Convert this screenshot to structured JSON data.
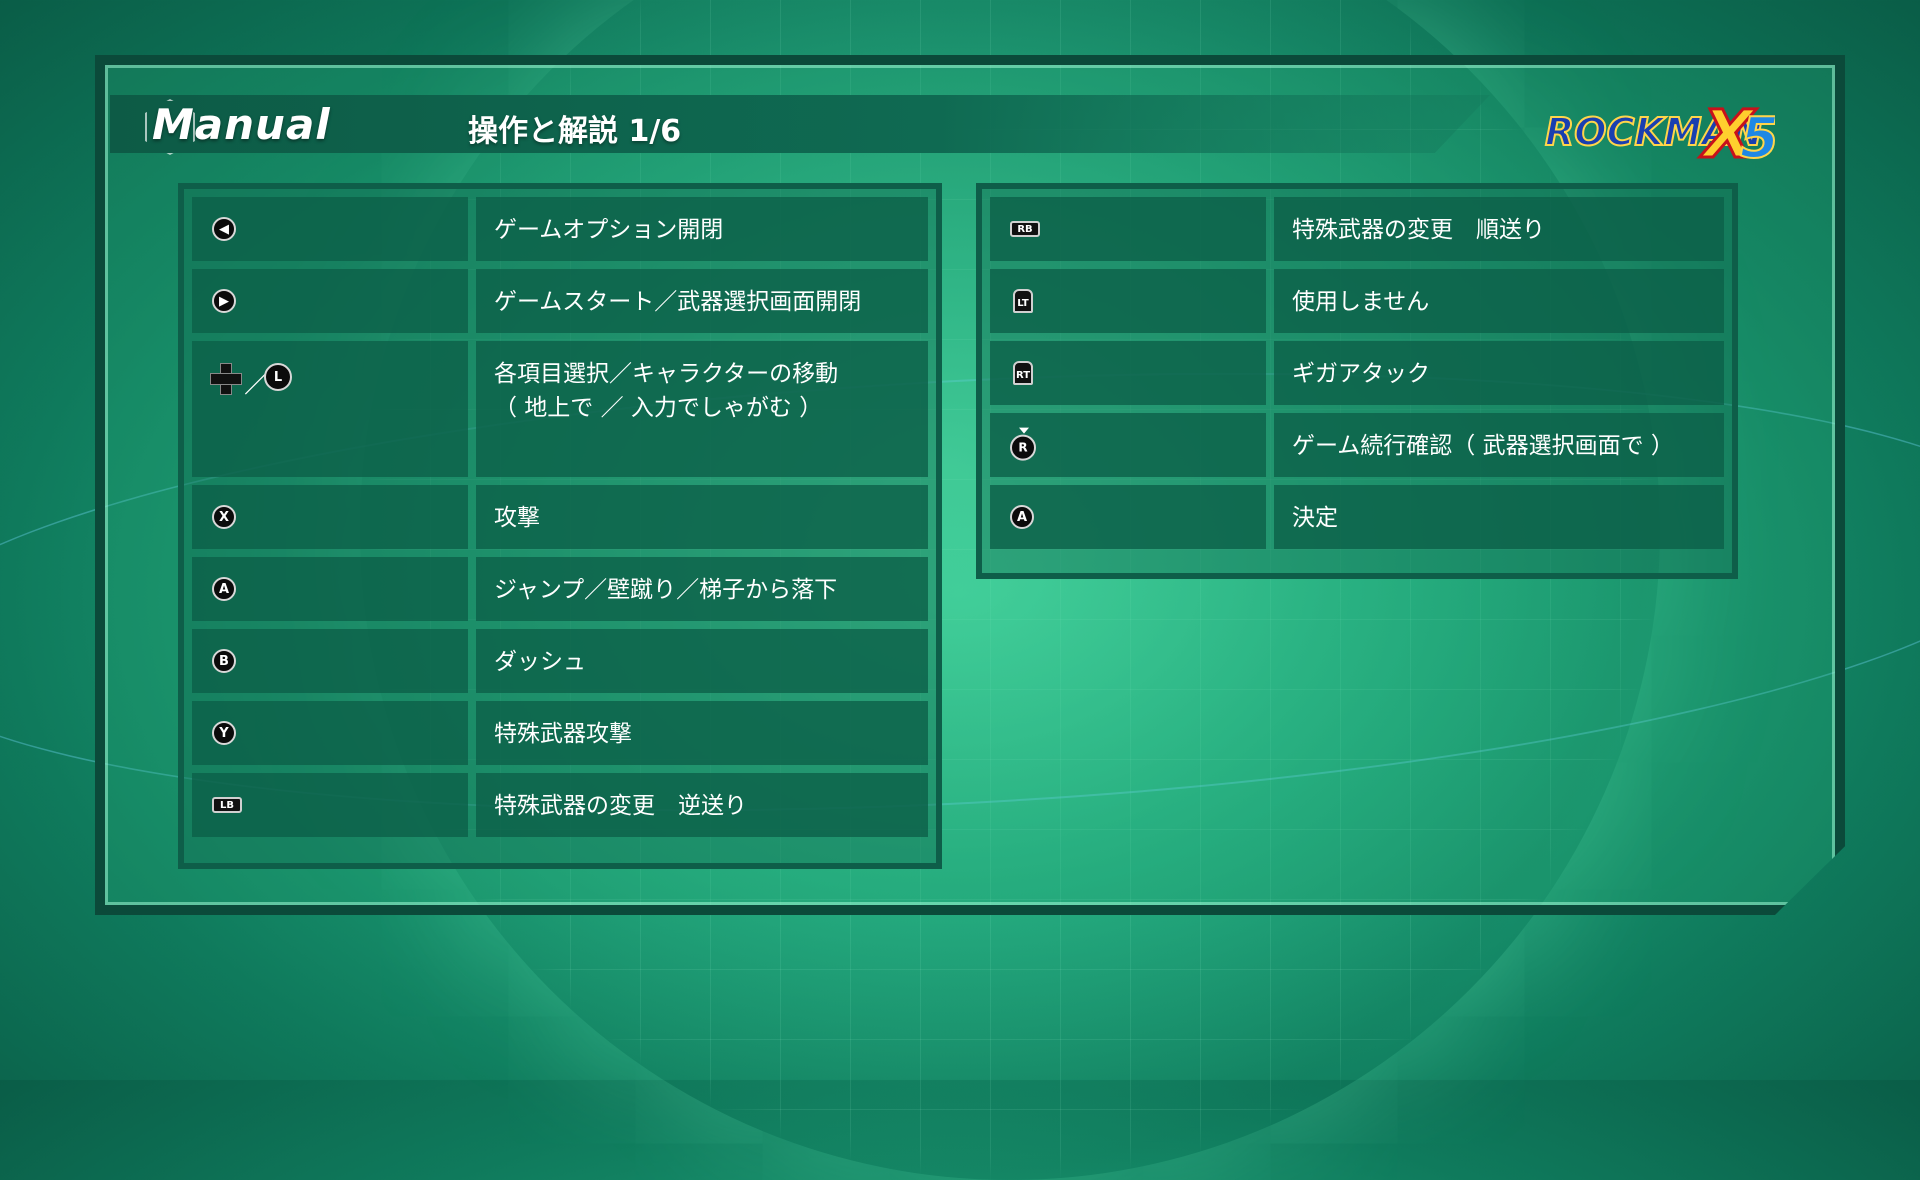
{
  "header": {
    "manual_label": "Manual",
    "page_title": "操作と解説 1/6",
    "logo_text": "ROCKMAN X5"
  },
  "left_panel": {
    "rows": [
      {
        "key_icon": "back-button-icon",
        "description": "ゲームオプション開閉"
      },
      {
        "key_icon": "start-button-icon",
        "description": "ゲームスタート／武器選択画面開閉"
      },
      {
        "key_icon": "dpad-or-left-stick-icon",
        "key_separator": "／",
        "key_label": "L",
        "description": "各項目選択／キャラクターの移動",
        "description_line2": "（ 地上で ／ 入力でしゃがむ ）"
      },
      {
        "key_icon": "x-button-icon",
        "key_label": "X",
        "description": "攻撃"
      },
      {
        "key_icon": "a-button-icon",
        "key_label": "A",
        "description": "ジャンプ／壁蹴り／梯子から落下"
      },
      {
        "key_icon": "b-button-icon",
        "key_label": "B",
        "description": "ダッシュ"
      },
      {
        "key_icon": "y-button-icon",
        "key_label": "Y",
        "description": "特殊武器攻撃"
      },
      {
        "key_icon": "lb-button-icon",
        "key_label": "LB",
        "description": "特殊武器の変更　逆送り"
      }
    ]
  },
  "right_panel": {
    "rows": [
      {
        "key_icon": "rb-button-icon",
        "key_label": "RB",
        "description": "特殊武器の変更　順送り"
      },
      {
        "key_icon": "lt-trigger-icon",
        "key_label": "LT",
        "description": "使用しません"
      },
      {
        "key_icon": "rt-trigger-icon",
        "key_label": "RT",
        "description": "ギガアタック"
      },
      {
        "key_icon": "right-stick-press-icon",
        "key_label": "R",
        "description": "ゲーム続行確認（ 武器選択画面で ）"
      },
      {
        "key_icon": "a-button-icon",
        "key_label": "A",
        "description": "決定"
      }
    ]
  },
  "colors": {
    "background": "#1fa57a",
    "panel_border": "#0e5e49",
    "cell_fill": "#0c5f48",
    "text": "#ffffff"
  }
}
